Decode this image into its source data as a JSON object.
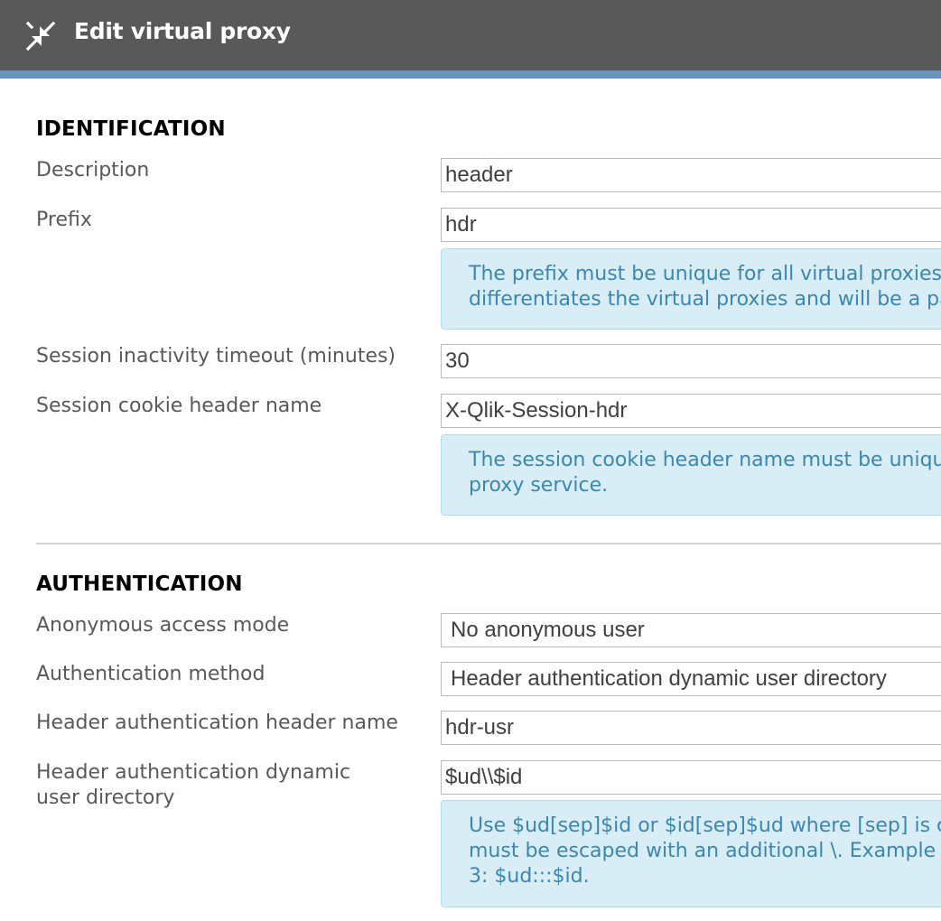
{
  "header": {
    "title": "Edit virtual proxy",
    "icon": "compress-arrows-icon",
    "background": "#595959",
    "accent": "#6b93c2"
  },
  "identification": {
    "heading": "IDENTIFICATION",
    "description": {
      "label": "Description",
      "value": "header"
    },
    "prefix": {
      "label": "Prefix",
      "value": "hdr",
      "info": "The prefix must be unique for all virtual proxies\ndifferentiates the virtual proxies and will be a pa"
    },
    "session_timeout": {
      "label": "Session inactivity timeout (minutes)",
      "value": "30"
    },
    "session_cookie": {
      "label": "Session cookie header name",
      "value": "X-Qlik-Session-hdr",
      "info": "The session cookie header name must be uniqu\nproxy service."
    }
  },
  "authentication": {
    "heading": "AUTHENTICATION",
    "anonymous_mode": {
      "label": "Anonymous access mode",
      "value": "No anonymous user"
    },
    "auth_method": {
      "label": "Authentication method",
      "value": "Header authentication dynamic user directory"
    },
    "header_name": {
      "label": "Header authentication header name",
      "value": "hdr-usr"
    },
    "dynamic_dir": {
      "label": "Header authentication dynamic\nuser directory",
      "value": "$ud\\\\$id",
      "info": "Use $ud[sep]$id or $id[sep]$ud where [sep] is c\nmust be escaped with an additional \\. Example\n3: $ud:::$id."
    }
  },
  "colors": {
    "info_background": "#d9edf7",
    "info_text": "#3a87b0",
    "label_text": "#595959"
  }
}
